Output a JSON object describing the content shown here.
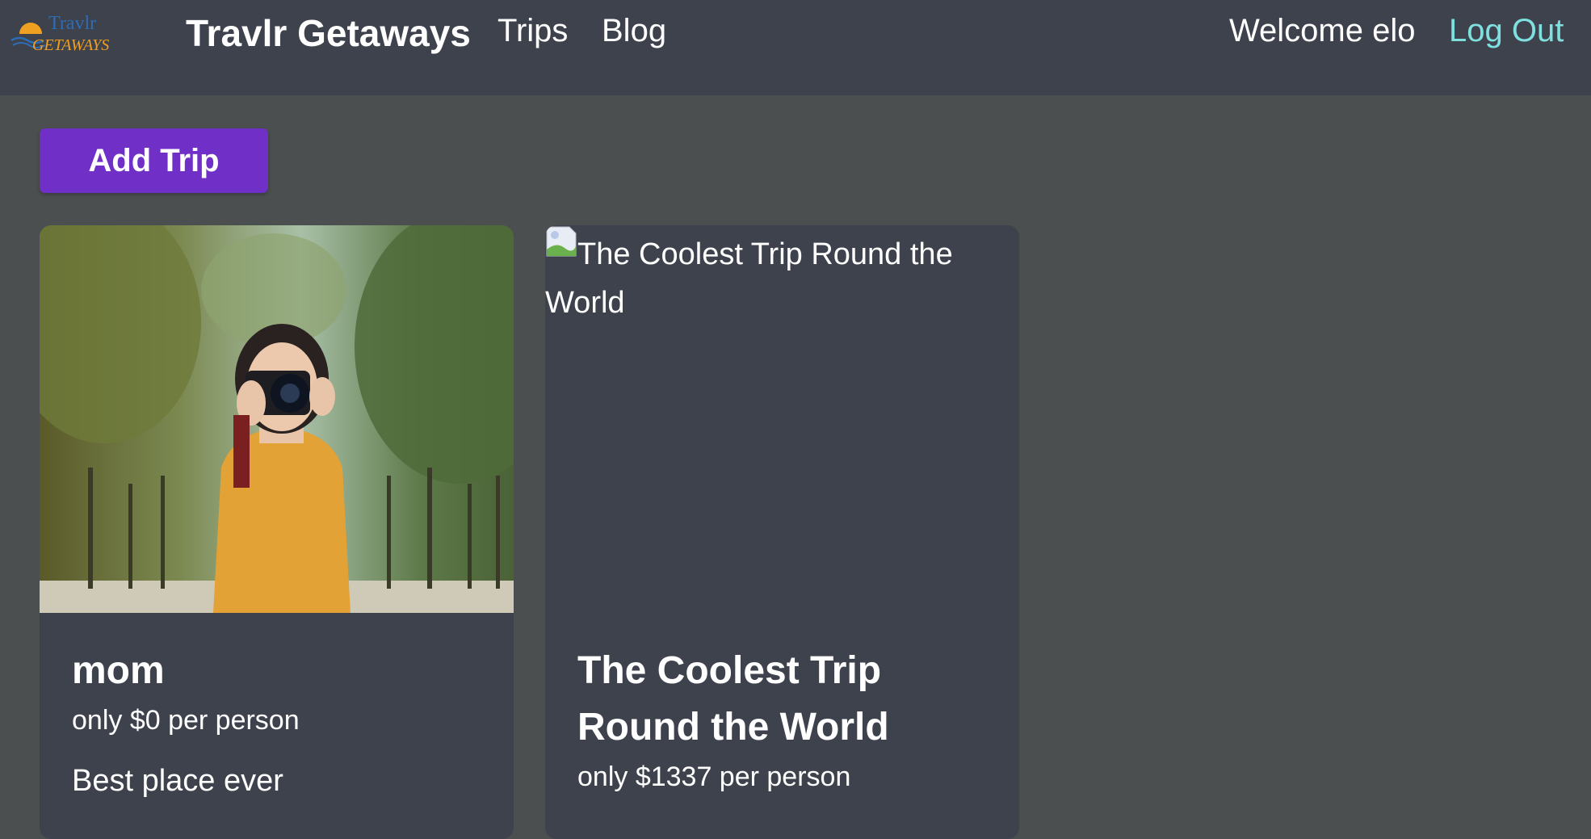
{
  "navbar": {
    "logo_text_top": "Travlr",
    "logo_text_bottom": "GETAWAYS",
    "brand": "Travlr Getaways",
    "links": [
      "Trips",
      "Blog"
    ],
    "welcome": "Welcome elo",
    "logout": "Log Out"
  },
  "actions": {
    "add_trip": "Add Trip"
  },
  "trips": [
    {
      "image_alt": "",
      "title": "mom",
      "price": "only $0 per person",
      "description": "Best place ever"
    },
    {
      "image_alt": "The Coolest Trip Round the World",
      "title": "The Coolest Trip Round the World",
      "price": "only $1337 per person",
      "description": ""
    }
  ],
  "colors": {
    "page_bg": "#4b4f50",
    "navbar_bg": "#3e424d",
    "card_bg": "#3e424d",
    "accent_button": "#7030c8",
    "logout_link": "#7fe0e0"
  }
}
